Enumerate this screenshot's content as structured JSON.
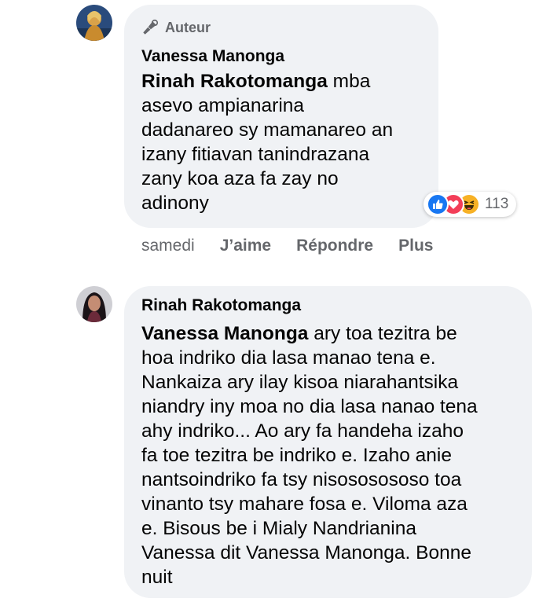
{
  "comments": [
    {
      "badge": "Auteur",
      "author": "Vanessa Manonga",
      "mention": "Rinah Rakotomanga",
      "text": " mba\nasevo ampianarina\ndadanareo sy mamanareo an\nizany fitiavan tanindrazana\nzany koa aza fa zay no\nadinony",
      "reactions": {
        "icons": [
          "like-icon",
          "love-icon",
          "haha-icon"
        ],
        "count": "113"
      },
      "actions": {
        "timestamp": "samedi",
        "like": "J’aime",
        "reply": "Répondre",
        "more": "Plus"
      }
    },
    {
      "author": "Rinah Rakotomanga",
      "mention": "Vanessa Manonga",
      "text": " ary toa tezitra be\nhoa indriko dia lasa manao tena e.\nNankaiza ary ilay kisoa niarahantsika\nniandry iny moa no dia lasa nanao tena\nahy indriko... Ao ary fa handeha izaho\nfa toe tezitra be indriko e. Izaho anie\nnantsoindriko fa tsy nisososososo toa\nvinanto tsy mahare fosa e. Viloma aza\ne. Bisous be i Mialy Nandrianina\nVanessa dit Vanessa Manonga. Bonne\nnuit"
    }
  ],
  "colors": {
    "bubble": "#f0f2f5",
    "secondary_text": "#65676b",
    "like_blue": "#1877f2",
    "love_red": "#f33e58",
    "haha_yellow": "#f7b125"
  }
}
